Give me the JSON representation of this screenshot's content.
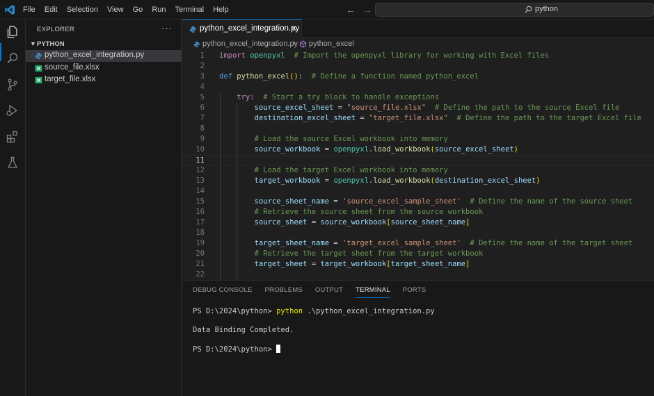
{
  "menu": [
    "File",
    "Edit",
    "Selection",
    "View",
    "Go",
    "Run",
    "Terminal",
    "Help"
  ],
  "search": {
    "text": "python"
  },
  "sidebar": {
    "title": "EXPLORER",
    "section": "PYTHON",
    "files": [
      {
        "name": "python_excel_integration.py",
        "type": "python",
        "active": true
      },
      {
        "name": "source_file.xlsx",
        "type": "excel"
      },
      {
        "name": "target_file.xlsx",
        "type": "excel"
      }
    ]
  },
  "editor": {
    "tab_label": "python_excel_integration.py",
    "breadcrumb": {
      "file": "python_excel_integration.py",
      "symbol": "python_excel"
    },
    "current_line": 11,
    "lines": [
      {
        "n": "1",
        "text": "import openpyxl  # Import the openpyxl library for working with Excel files"
      },
      {
        "n": "2",
        "text": ""
      },
      {
        "n": "3",
        "text": "def python_excel():  # Define a function named python_excel"
      },
      {
        "n": "4",
        "text": ""
      },
      {
        "n": "5",
        "text": "    try:  # Start a try block to handle exceptions"
      },
      {
        "n": "6",
        "text": "        source_excel_sheet = \"source_file.xlsx\"  # Define the path to the source Excel file"
      },
      {
        "n": "7",
        "text": "        destination_excel_sheet = \"target_file.xlsx\"  # Define the path to the target Excel file"
      },
      {
        "n": "8",
        "text": ""
      },
      {
        "n": "9",
        "text": "        # Load the source Excel workbook into memory"
      },
      {
        "n": "10",
        "text": "        source_workbook = openpyxl.load_workbook(source_excel_sheet)"
      },
      {
        "n": "11",
        "text": ""
      },
      {
        "n": "12",
        "text": "        # Load the target Excel workbook into memory"
      },
      {
        "n": "13",
        "text": "        target_workbook = openpyxl.load_workbook(destination_excel_sheet)"
      },
      {
        "n": "14",
        "text": ""
      },
      {
        "n": "15",
        "text": "        source_sheet_name = 'source_excel_sample_sheet'  # Define the name of the source sheet"
      },
      {
        "n": "16",
        "text": "        # Retrieve the source sheet from the source workbook"
      },
      {
        "n": "17",
        "text": "        source_sheet = source_workbook[source_sheet_name]"
      },
      {
        "n": "18",
        "text": ""
      },
      {
        "n": "19",
        "text": "        target_sheet_name = 'target_excel_sample_sheet'  # Define the name of the target sheet"
      },
      {
        "n": "20",
        "text": "        # Retrieve the target sheet from the target workbook"
      },
      {
        "n": "21",
        "text": "        target_sheet = target_workbook[target_sheet_name]"
      },
      {
        "n": "22",
        "text": ""
      }
    ]
  },
  "panel": {
    "tabs": [
      "DEBUG CONSOLE",
      "PROBLEMS",
      "OUTPUT",
      "TERMINAL",
      "PORTS"
    ],
    "active_tab": "TERMINAL",
    "terminal": {
      "prompt1": "PS D:\\2024\\python> ",
      "cmd": "python",
      "arg": " .\\python_excel_integration.py",
      "output": "Data Binding Completed.",
      "prompt2": "PS D:\\2024\\python> "
    }
  },
  "colors": {
    "accent": "#0078d4",
    "keyword": "#c586c0",
    "def_keyword": "#569cd6",
    "function": "#dcdcaa",
    "variable": "#9cdcfe",
    "comment": "#6a9955",
    "string": "#ce9178",
    "module": "#4ec9b0"
  }
}
